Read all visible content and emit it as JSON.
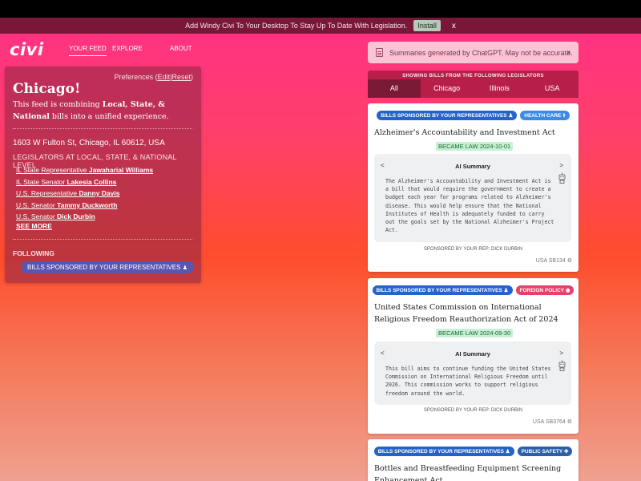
{
  "banner": {
    "text": "Add Windy Civi To Your Desktop To Stay Up To Date With Legislation.",
    "install_label": "Install",
    "close_label": "x"
  },
  "header": {
    "logo": "civi",
    "nav": [
      "YOUR FEED",
      "EXPLORE",
      "ABOUT"
    ]
  },
  "feed": {
    "preferences_label": "Preferences",
    "edit_label": "Edit",
    "reset_label": "Reset",
    "city": "Chicago!",
    "desc_prefix": "This feed is combining ",
    "desc_levels": "Local, State, & National",
    "desc_suffix": " bills into a unified experience.",
    "address": "1603 W Fulton St, Chicago, IL 60612, USA",
    "legislators_heading": "LEGISLATORS AT LOCAL, STATE, & NATIONAL LEVEL",
    "legislators": [
      {
        "role": "IL State Representative ",
        "name": "Jawaharial Williams"
      },
      {
        "role": "IL State Senator ",
        "name": "Lakesia Collins"
      },
      {
        "role": "U.S. Representative ",
        "name": "Danny Davis"
      },
      {
        "role": "U.S. Senator ",
        "name": "Tammy Duckworth"
      },
      {
        "role": "U.S. Senator ",
        "name": "Dick Durbin"
      }
    ],
    "see_more": "SEE MORE",
    "following_heading": "FOLLOWING",
    "following_chip": "BILLS SPONSORED BY YOUR REPRESENTATIVES"
  },
  "notice": {
    "text": "Summaries generated by ChatGPT. May not be accurate.",
    "close_label": "x"
  },
  "filter": {
    "heading": "SHOWING BILLS FROM THE FOLLOWING LEGISLATORS",
    "tabs": [
      "All",
      "Chicago",
      "Illinois",
      "USA"
    ],
    "active_tab": "All"
  },
  "bills": [
    {
      "chips": [
        "BILLS SPONSORED BY YOUR REPRESENTATIVES",
        "HEALTH CARE"
      ],
      "title": "Alzheimer's Accountability and Investment Act",
      "status": "BECAME LAW 2024-10-01",
      "summary_title": "AI Summary",
      "summary": "The Alzheimer's Accountability and Investment Act is a bill that would require the government to create a budget each year for programs related to Alzheimer's disease. This would help ensure that the National Institutes of Health is adequately funded to carry out the goals set by the National Alzheimer's Project Act.",
      "sponsor": "SPONSORED BY YOUR REP: DICK DURBIN",
      "bill_id": "USA SB134"
    },
    {
      "chips": [
        "BILLS SPONSORED BY YOUR REPRESENTATIVES",
        "FOREIGN POLICY"
      ],
      "title": "United States Commission on International Religious Freedom Reauthorization Act of 2024",
      "status": "BECAME LAW 2024-09-30",
      "summary_title": "AI Summary",
      "summary": "This bill aims to continue funding the United States Commission on International Religious Freedom until 2026. This commission works to support religious freedom around the world.",
      "sponsor": "SPONSORED BY YOUR REP: DICK DURBIN",
      "bill_id": "USA SB3764"
    },
    {
      "chips": [
        "BILLS SPONSORED BY YOUR REPRESENTATIVES",
        "PUBLIC SAFETY"
      ],
      "title": "Bottles and Breastfeeding Equipment Screening Enhancement Act"
    }
  ]
}
